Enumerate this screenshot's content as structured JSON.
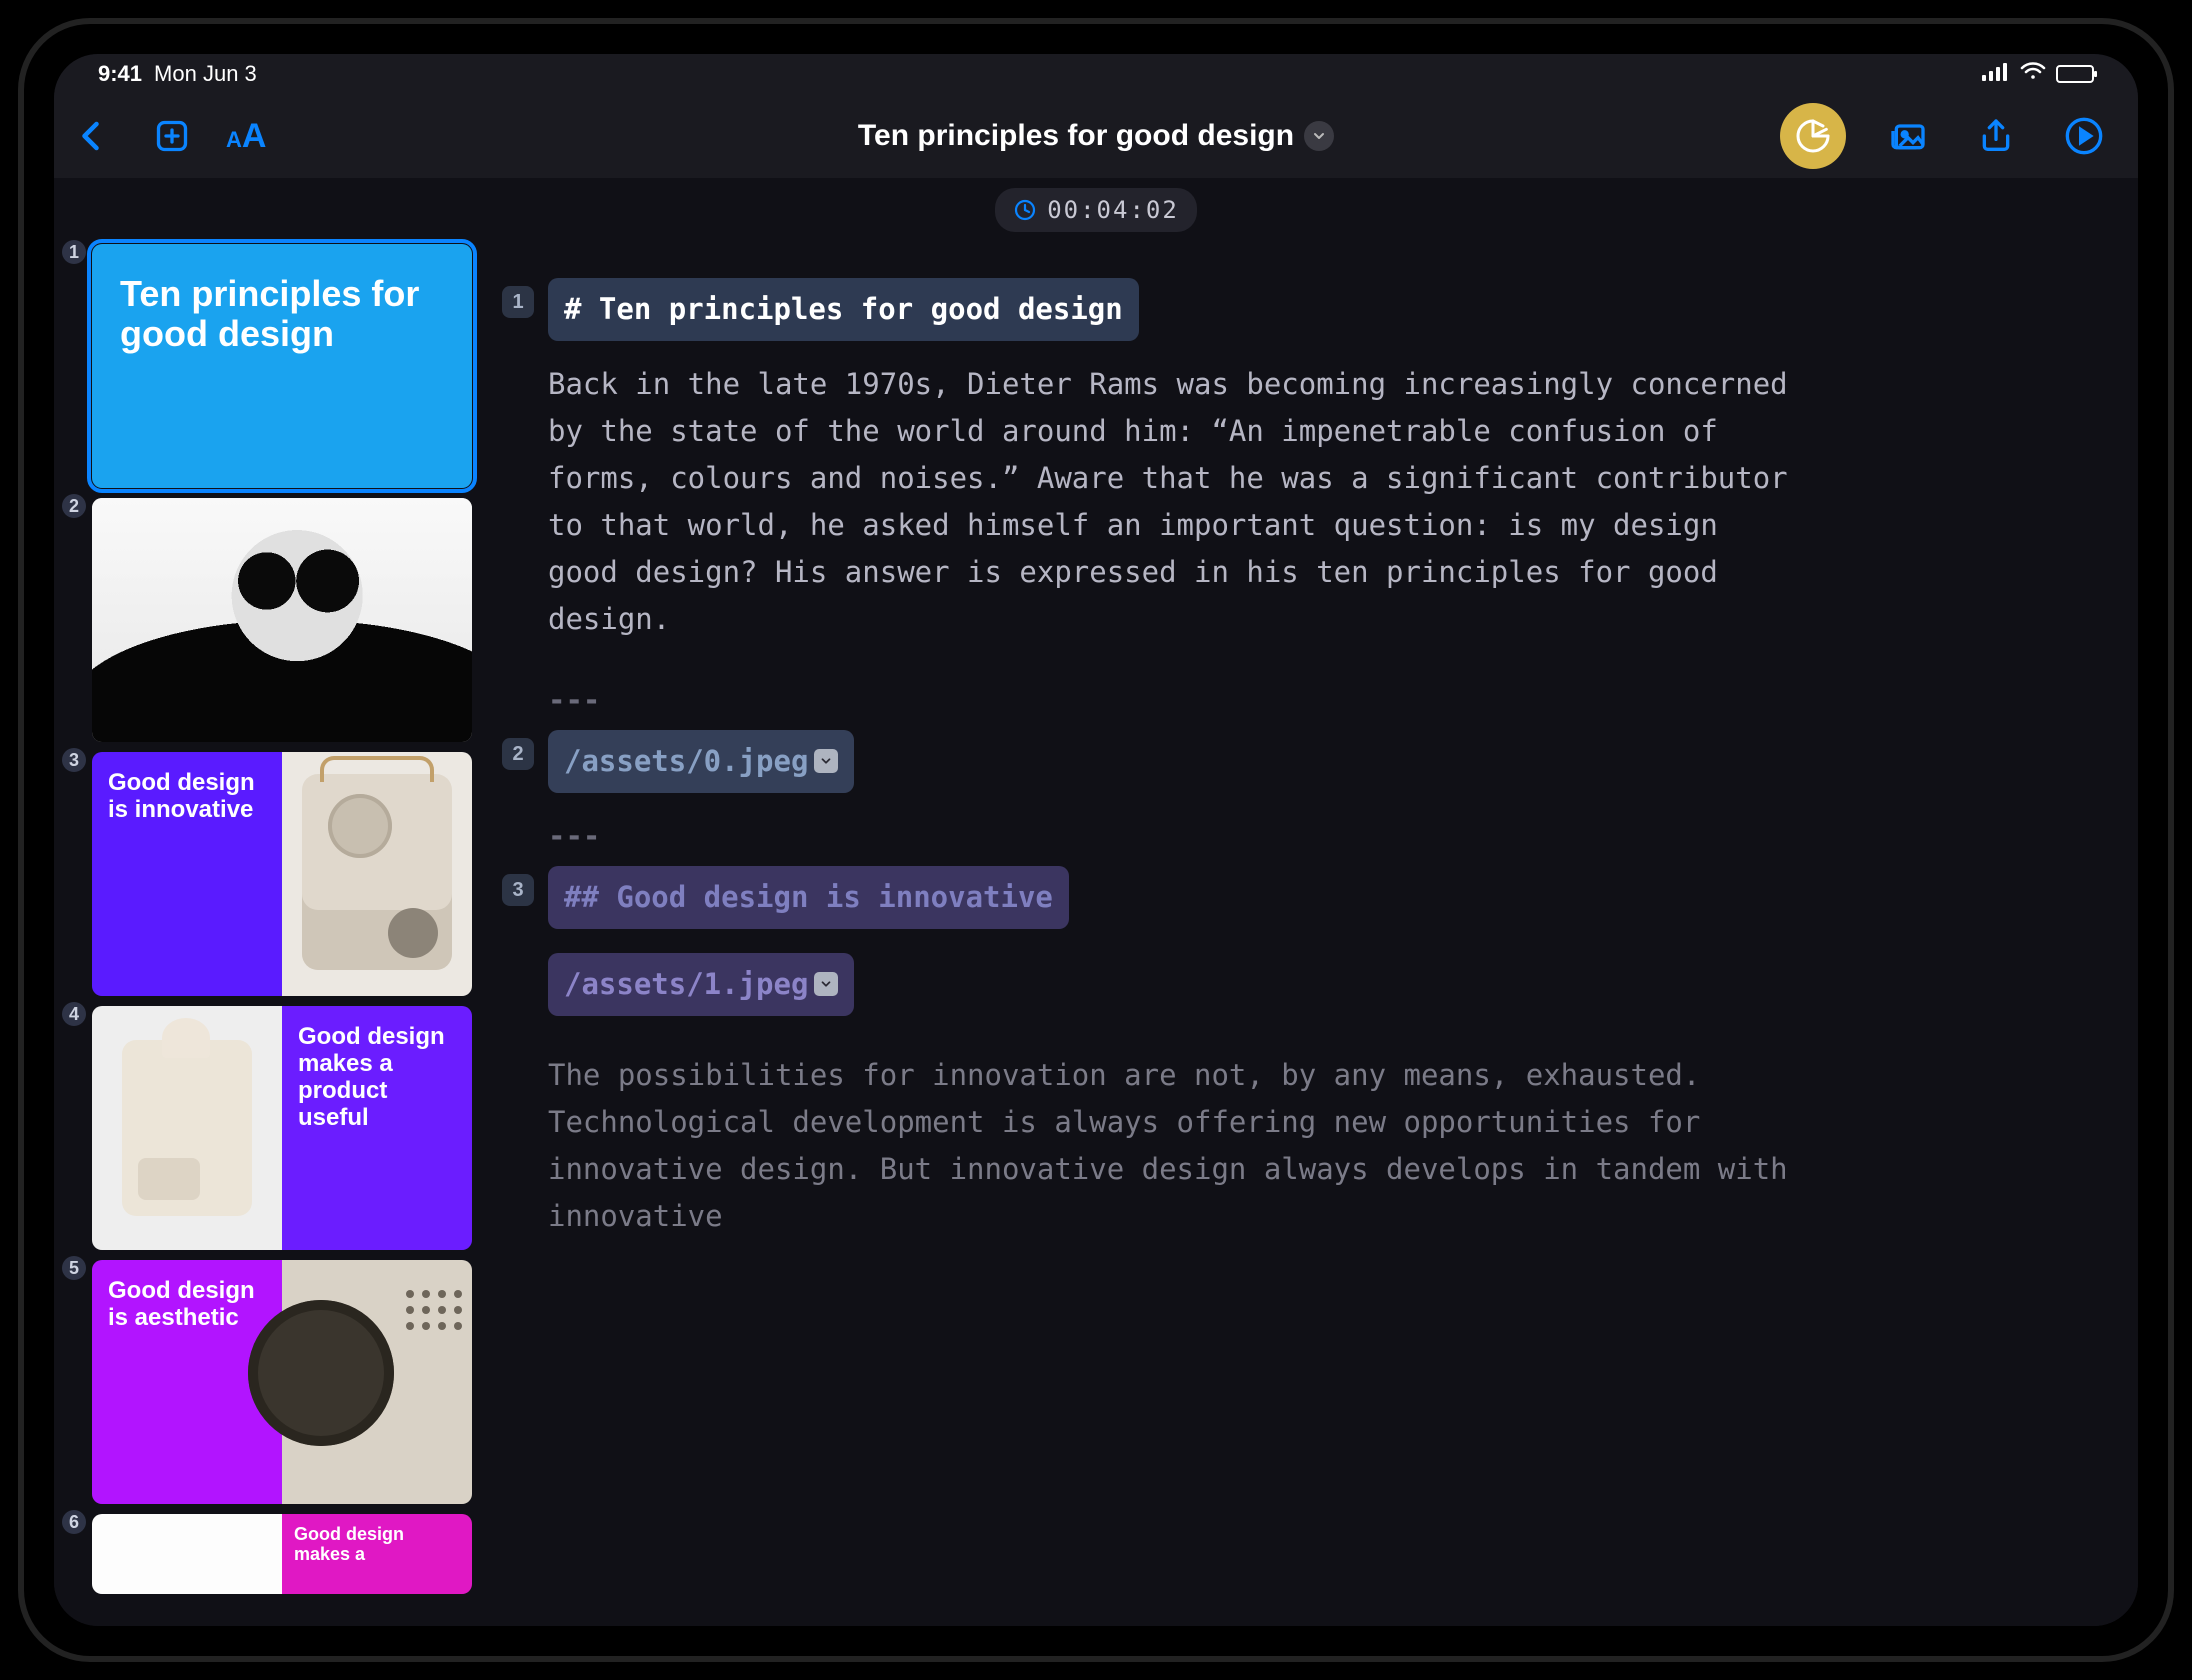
{
  "status": {
    "time": "9:41",
    "date": "Mon Jun 3"
  },
  "toolbar": {
    "title": "Ten principles for good design"
  },
  "timer": "00:04:02",
  "sidebar": {
    "slides": [
      {
        "num": "1",
        "title": "Ten principles for good design"
      },
      {
        "num": "2",
        "title": ""
      },
      {
        "num": "3",
        "title": "Good design is innovative"
      },
      {
        "num": "4",
        "title": "Good design makes a product useful"
      },
      {
        "num": "5",
        "title": "Good design is aesthetic"
      },
      {
        "num": "6",
        "title": "Good design makes a"
      }
    ]
  },
  "editor": {
    "block1_num": "1",
    "block1_text": "# Ten principles for good design",
    "para1": "Back in the late 1970s, Dieter Rams was becoming increasingly concerned by the state of the world around him: “An impenetrable confusion of forms, colours and noises.” Aware that he was a significant contributor to that world, he asked himself an important question: is my design good design? His answer is expressed in his ten principles for good design.",
    "hr": "---",
    "block2_num": "2",
    "block2_text": "/assets/0.jpeg",
    "block3_num": "3",
    "block3_text": "## Good design is innovative",
    "block3_asset": "/assets/1.jpeg",
    "para2": "The possibilities for innovation are not, by any means, exhausted. Technological development is always offering new opportunities for innovative design. But innovative design always develops in tandem with innovative"
  }
}
